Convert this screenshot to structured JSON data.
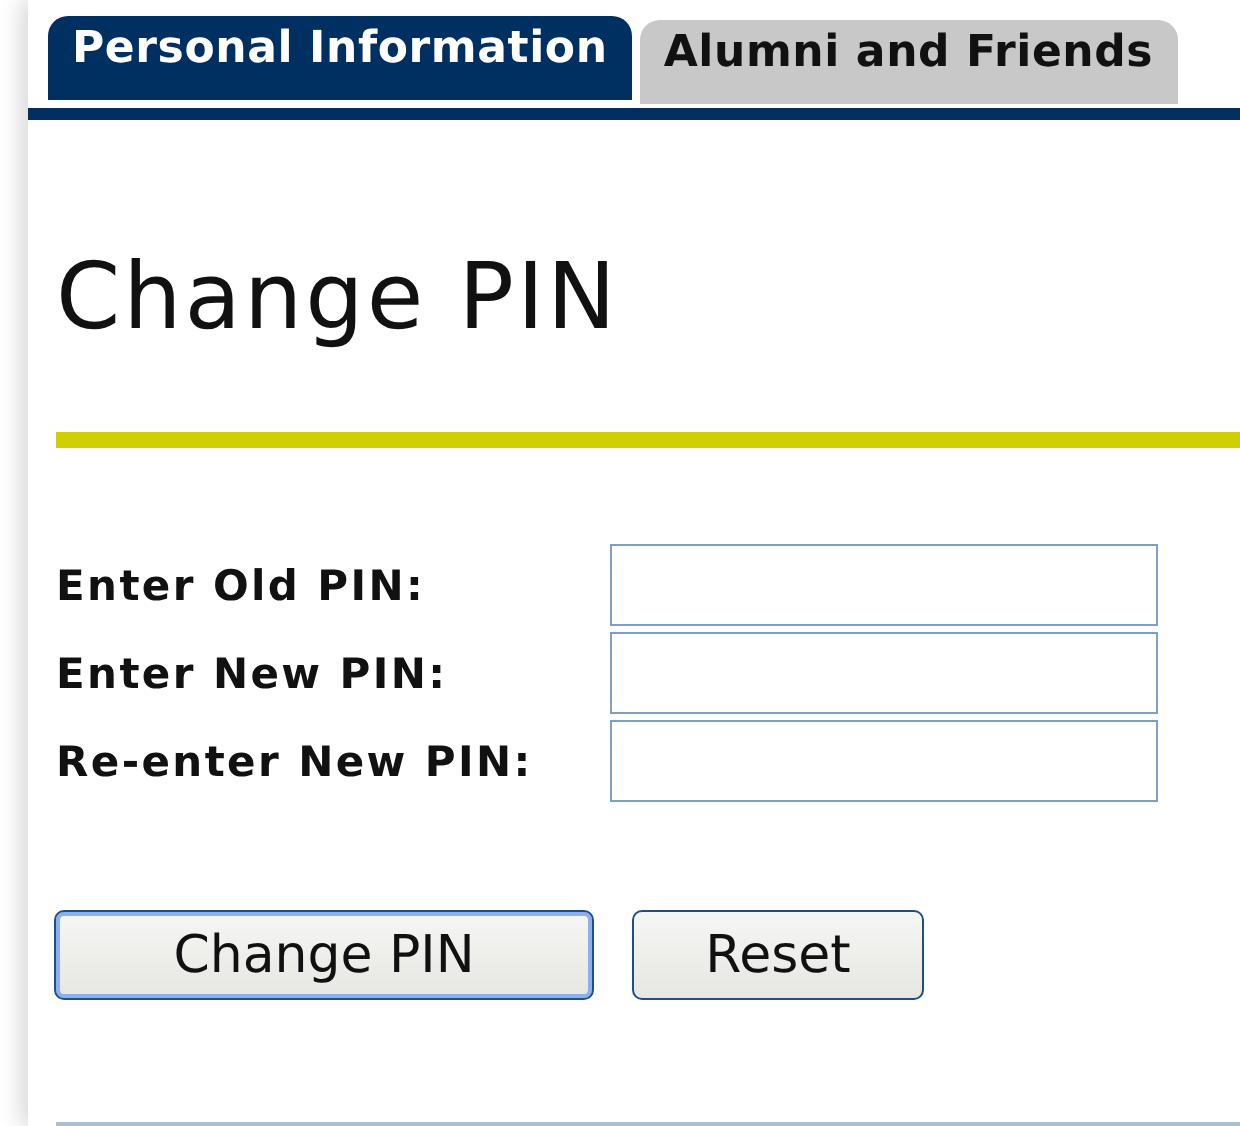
{
  "tabs": [
    {
      "label": "Personal Information",
      "selected": true
    },
    {
      "label": "Alumni and Friends",
      "selected": false
    }
  ],
  "heading": "Change PIN",
  "fields": [
    {
      "label": "Enter Old PIN:"
    },
    {
      "label": "Enter New PIN:"
    },
    {
      "label": "Re-enter New PIN:"
    }
  ],
  "buttons": [
    {
      "label": "Change PIN",
      "focused": true
    },
    {
      "label": "Reset",
      "focused": false
    }
  ]
}
